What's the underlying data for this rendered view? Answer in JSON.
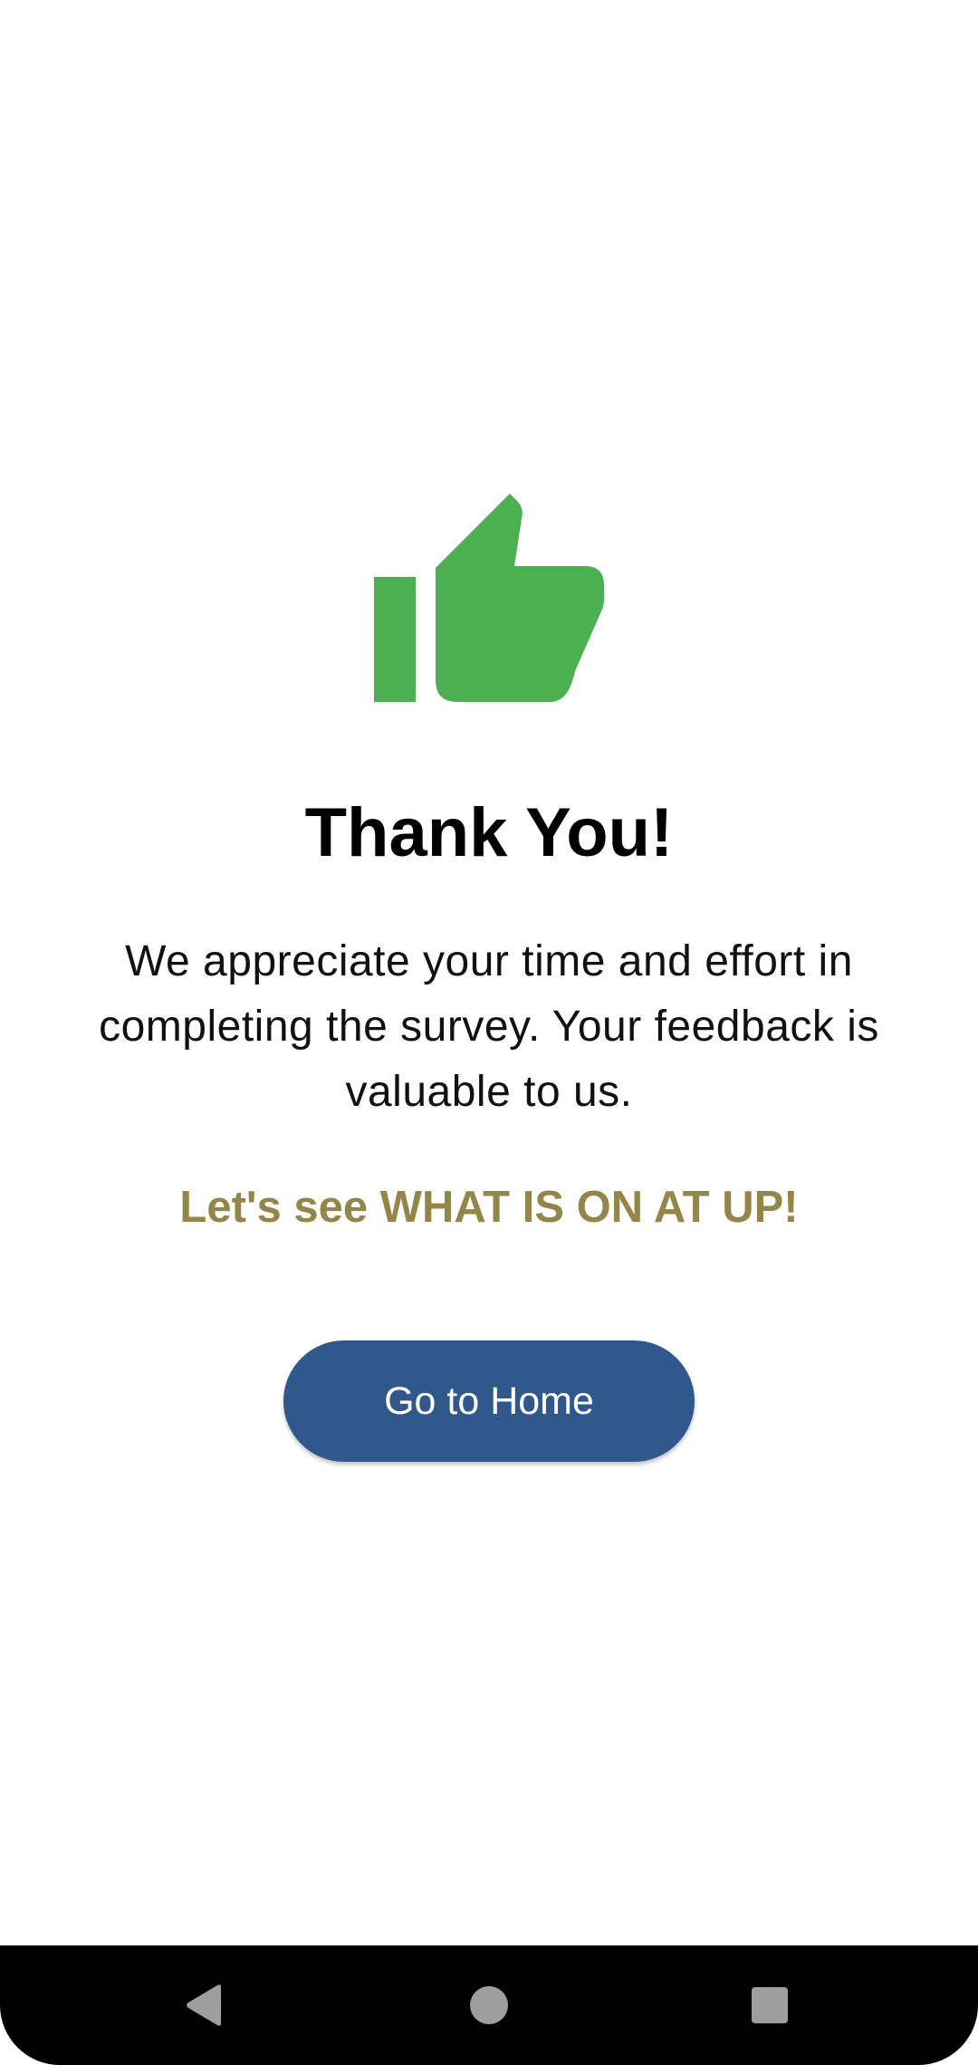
{
  "confirmation": {
    "icon": "thumbs-up-icon",
    "icon_color": "#4caf50",
    "title": "Thank You!",
    "message": "We appreciate your time and effort in completing the survey. Your feedback is valuable to us.",
    "tagline": "Let's see WHAT IS ON AT UP!",
    "tagline_color": "#948548",
    "button_label": "Go to Home",
    "button_color": "#31588c"
  },
  "navbar": {
    "buttons": [
      "back-icon",
      "home-icon",
      "recents-icon"
    ],
    "icon_color": "#9e9e9e"
  }
}
